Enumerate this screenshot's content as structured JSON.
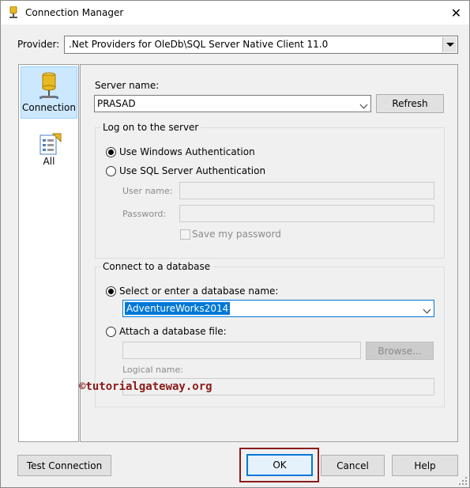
{
  "window": {
    "title": "Connection Manager",
    "close_glyph": "✕"
  },
  "provider": {
    "label": "Provider:",
    "value": ".Net Providers for OleDb\\SQL Server Native Client 11.0"
  },
  "sidebar": {
    "items": [
      {
        "label": "Connection",
        "icon": "database-icon",
        "selected": true
      },
      {
        "label": "All",
        "icon": "properties-icon",
        "selected": false
      }
    ]
  },
  "server": {
    "label": "Server name:",
    "value": "PRASAD",
    "refresh_label": "Refresh"
  },
  "logon": {
    "title": "Log on to the server",
    "windows_auth_label": "Use Windows Authentication",
    "sql_auth_label": "Use SQL Server Authentication",
    "username_label": "User name:",
    "username_value": "",
    "password_label": "Password:",
    "password_value": "",
    "save_password_label": "Save my password"
  },
  "database": {
    "title": "Connect to a database",
    "select_label": "Select or enter a database name:",
    "db_value": "AdventureWorks2014",
    "attach_label": "Attach a database file:",
    "file_value": "",
    "browse_label": "Browse...",
    "logical_label": "Logical name:",
    "logical_value": ""
  },
  "watermark": "©tutorialgateway.org",
  "footer": {
    "test_label": "Test Connection",
    "ok_label": "OK",
    "cancel_label": "Cancel",
    "help_label": "Help"
  },
  "colors": {
    "accent": "#0078d7",
    "highlight": "#8b1a1a",
    "selected_bg": "#cce8ff"
  }
}
